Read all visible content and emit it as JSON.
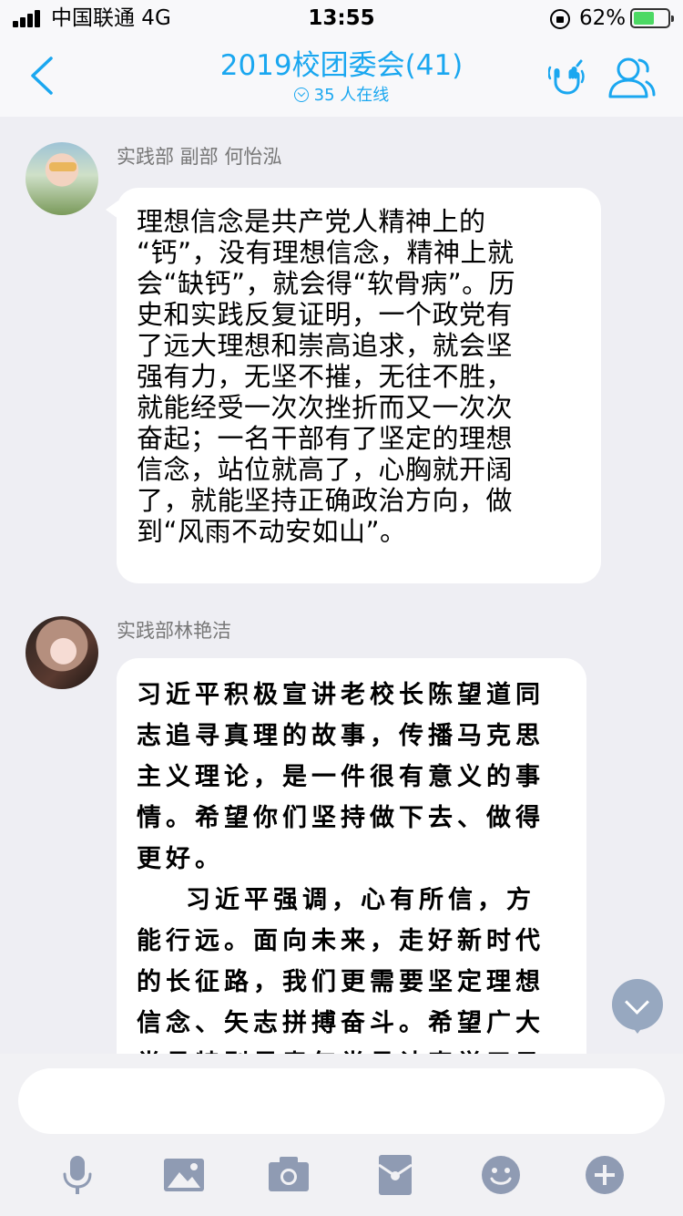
{
  "status_bar": {
    "carrier": "中国联通  4G",
    "time": "13:55",
    "battery_percent": "62%",
    "battery_level": 0.62,
    "icons": [
      "signal-icon",
      "orientation-lock-icon",
      "battery-charging-icon"
    ]
  },
  "header": {
    "title": "2019校团委会(41)",
    "online_text": "35 人在线",
    "icons": [
      "back-icon",
      "hand-gesture-icon",
      "group-members-icon"
    ]
  },
  "messages": [
    {
      "sender": "实践部 副部 何怡泓",
      "lines": [
        "理想信念是共产党人精神上的",
        "“钙”，没有理想信念，精神上就",
        "会“缺钙”，就会得“软骨病”。历",
        "史和实践反复证明，一个政党有",
        "了远大理想和崇高追求，就会坚",
        "强有力，无坚不摧，无往不胜，",
        "就能经受一次次挫折而又一次次",
        "奋起；一名干部有了坚定的理想",
        "信念，站位就高了，心胸就开阔",
        "了，就能坚持正确政治方向，做",
        "到“风雨不动安如山”。"
      ]
    },
    {
      "sender": "实践部林艳洁",
      "lines": [
        "习近平积极宣讲老校长陈望道同",
        "志追寻真理的故事，传播马克思",
        "主义理论，是一件很有意义的事",
        "情。希望你们坚持做下去、做得",
        "更好。",
        "习近平强调，心有所信，方",
        "能行远。面向未来，走好新时代",
        "的长征路，我们更需要坚定理想",
        "信念、矢志拼搏奋斗。希望广大",
        "党员特别是青年党员认真学习马"
      ]
    }
  ],
  "input": {
    "value": "",
    "placeholder": ""
  },
  "toolbar": {
    "icons": [
      "microphone-icon",
      "image-icon",
      "camera-icon",
      "red-packet-icon",
      "emoji-icon",
      "plus-icon"
    ]
  },
  "colors": {
    "accent": "#1aa7f0",
    "icon_gray": "#8f9bb3",
    "scroll_button": "#97a8c0",
    "background": "#eeeef3"
  }
}
